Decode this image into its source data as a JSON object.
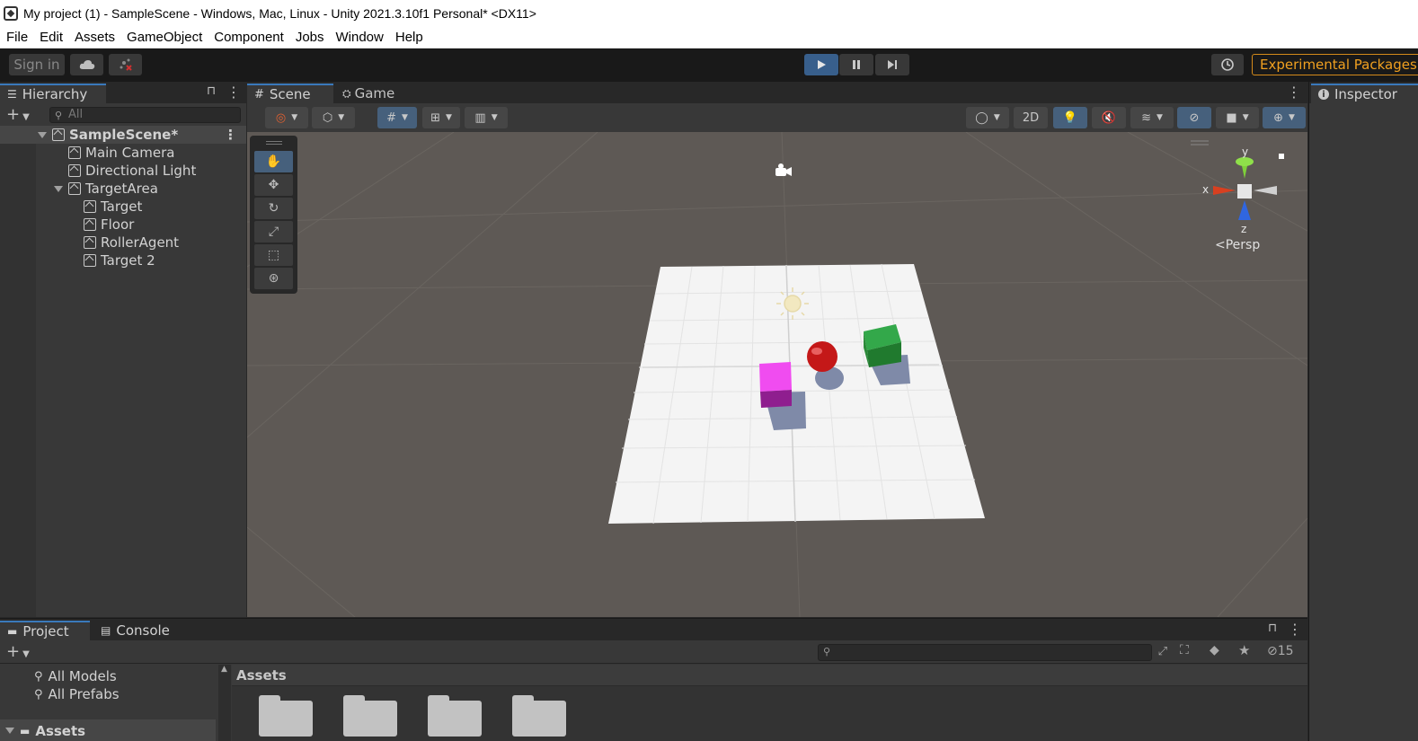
{
  "window": {
    "title": "My project (1) - SampleScene - Windows, Mac, Linux - Unity 2021.3.10f1 Personal* <DX11>"
  },
  "menu": [
    "File",
    "Edit",
    "Assets",
    "GameObject",
    "Component",
    "Jobs",
    "Window",
    "Help"
  ],
  "toolbar": {
    "sign_in": "Sign in",
    "experimental": "Experimental Packages"
  },
  "hierarchy": {
    "tab": "Hierarchy",
    "search_placeholder": "All",
    "items": [
      {
        "label": "SampleScene*"
      },
      {
        "label": "Main Camera"
      },
      {
        "label": "Directional Light"
      },
      {
        "label": "TargetArea"
      },
      {
        "label": "Target"
      },
      {
        "label": "Floor"
      },
      {
        "label": "RollerAgent"
      },
      {
        "label": "Target 2"
      }
    ]
  },
  "scene": {
    "tabs": [
      "Scene",
      "Game"
    ],
    "btn_2d": "2D",
    "gizmo": {
      "x": "x",
      "y": "y",
      "z": "z",
      "projection": "<Persp"
    }
  },
  "inspector": {
    "tab": "Inspector"
  },
  "project": {
    "tabs": [
      "Project",
      "Console"
    ],
    "favorites": [
      "All Models",
      "All Prefabs"
    ],
    "root": "Assets",
    "breadcrumb": "Assets",
    "hidden_count": "15"
  },
  "colors": {
    "accent": "#3a79bb",
    "play_active": "#385f8c",
    "experimental": "#f0a020",
    "viewport_bg": "#5e5955",
    "target_cube": "#e03ee0",
    "agent_sphere": "#c61818",
    "target2_cube": "#2f9e3a"
  }
}
